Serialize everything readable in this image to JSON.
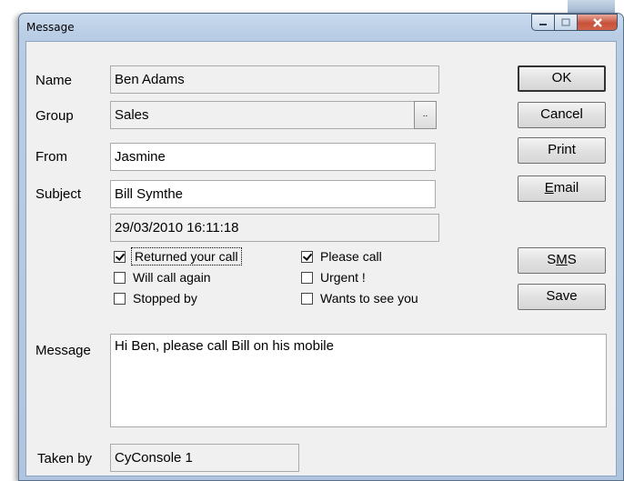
{
  "window": {
    "title": "Message"
  },
  "form": {
    "name_label": "Name",
    "name_value": "Ben Adams",
    "group_label": "Group",
    "group_value": "Sales",
    "group_browse": "..",
    "from_label": "From",
    "from_value": "Jasmine",
    "subject_label": "Subject",
    "subject_value": "Bill Symthe",
    "datetime_value": "29/03/2010 16:11:18",
    "message_label": "Message",
    "message_value": "Hi Ben, please call Bill on his mobile",
    "taken_by_label": "Taken by",
    "taken_by_value": "CyConsole 1"
  },
  "checkboxes": {
    "returned_call": {
      "label": "Returned your call",
      "checked": true
    },
    "will_call_again": {
      "label": "Will call again",
      "checked": false
    },
    "stopped_by": {
      "label": "Stopped by",
      "checked": false
    },
    "please_call": {
      "label": "Please call",
      "checked": true
    },
    "urgent": {
      "label": "Urgent !",
      "checked": false
    },
    "wants_to_see": {
      "label": "Wants to see you",
      "checked": false
    }
  },
  "buttons": {
    "ok": "OK",
    "cancel": "Cancel",
    "print": "Print",
    "email_prefix": "",
    "email_mnemonic": "E",
    "email_rest": "mail",
    "sms_prefix": "S",
    "sms_mnemonic": "M",
    "sms_rest": "S",
    "save": "Save"
  },
  "icons": {
    "minimize": "minimize-icon",
    "maximize": "maximize-icon",
    "close": "close-icon"
  }
}
